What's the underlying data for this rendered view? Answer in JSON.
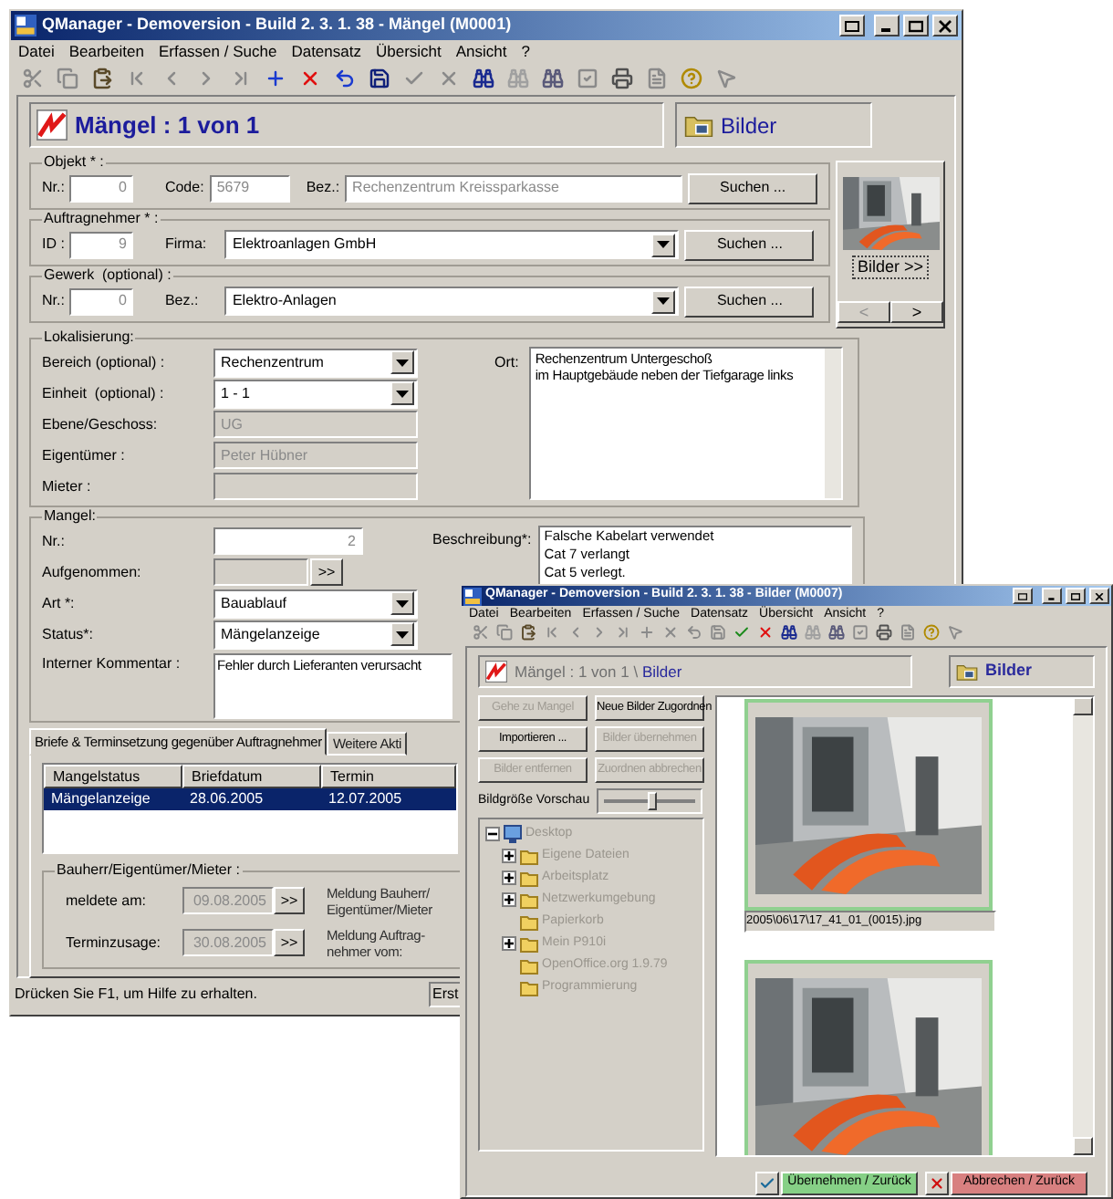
{
  "main_window": {
    "title": "QManager - Demoversion - Build 2. 3. 1. 38 - Mängel (M0001)",
    "menu": [
      "Datei",
      "Bearbeiten",
      "Erfassen / Suche",
      "Datensatz",
      "Übersicht",
      "Ansicht",
      "?"
    ],
    "header": {
      "title": "Mängel : 1 von 1",
      "images_label": "Bilder"
    },
    "objekt": {
      "legend": "Objekt * :",
      "nr_label": "Nr.:",
      "nr": "0",
      "code_label": "Code:",
      "code": "5679",
      "bez_label": "Bez.:",
      "bez": "Rechenzentrum Kreissparkasse",
      "button": "Suchen ..."
    },
    "auftragnehmer": {
      "legend": "Auftragnehmer * :",
      "id_label": "ID :",
      "id": "9",
      "firma_label": "Firma:",
      "firma": "Elektroanlagen GmbH",
      "button": "Suchen ..."
    },
    "gewerk": {
      "legend": "Gewerk  (optional) :",
      "nr_label": "Nr.:",
      "nr": "0",
      "bez_label": "Bez.:",
      "bez": "Elektro-Anlagen",
      "button": "Suchen ..."
    },
    "thumbnail": {
      "kind": "picture",
      "button": "Bilder >>",
      "prev": "<",
      "next": ">"
    },
    "lokalisierung": {
      "legend": "Lokalisierung:",
      "fields": [
        {
          "label": "Bereich (optional) :",
          "value": "Rechenzentrum",
          "kind": "combo"
        },
        {
          "label": "Einheit  (optional) :",
          "value": "1 - 1",
          "kind": "combo"
        },
        {
          "label": "Ebene/Geschoss:",
          "value": "UG",
          "kind": "readonly"
        },
        {
          "label": "Eigentümer :",
          "value": "Peter Hübner",
          "kind": "readonly"
        },
        {
          "label": "Mieter :",
          "kind": "readonly"
        }
      ],
      "ort_label": "Ort:",
      "ort": [
        "Rechenzentrum Untergeschoß",
        "im Hauptgebäude neben der Tiefgarage links"
      ]
    },
    "mangel": {
      "legend": "Mangel:",
      "fields": [
        {
          "label": "Nr.:",
          "value": "2",
          "kind": "number"
        },
        {
          "label": "Aufgenommen:",
          "kind": "date",
          "button": ">>"
        },
        {
          "label": "Art *:",
          "value": "Bauablauf",
          "kind": "combo"
        },
        {
          "label": "Status*:",
          "value": "Mängelanzeige",
          "kind": "combo"
        }
      ],
      "beschreibung_label": "Beschreibung*:",
      "beschreibung": [
        "Falsche Kabelart verwendet",
        "Cat 7 verlangt",
        "Cat 5 verlegt."
      ],
      "kommentar_label": "Interner Kommentar :",
      "kommentar": "Fehler durch Lieferanten verursacht"
    },
    "tabs": [
      {
        "label": "Briefe & Terminsetzung gegenüber Auftragnehmer",
        "selected": true
      },
      {
        "label": "Weitere Akti",
        "selected": false
      }
    ],
    "table": {
      "columns": [
        "Mangelstatus",
        "Briefdatum",
        "Termin"
      ],
      "rows": [
        {
          "cells": [
            "Mängelanzeige",
            "28.06.2005",
            "12.07.2005"
          ],
          "selected": true
        }
      ]
    },
    "bauherr": {
      "legend": "Bauherr/Eigentümer/Mieter :",
      "rows": [
        {
          "label": "meldete am:",
          "value": "09.08.2005",
          "button": ">>",
          "note": [
            "Meldung Bauherr/",
            "Eigentümer/Mieter"
          ]
        },
        {
          "label": "Terminzusage:",
          "value": "30.08.2005",
          "button": ">>",
          "note": [
            "Meldung Auftrag-",
            "nehmer vom:"
          ]
        }
      ]
    },
    "status_bar": [
      "Drücken Sie F1, um Hilfe zu erhalten.",
      "Erst"
    ]
  },
  "images_window": {
    "title": "QManager - Demoversion - Build 2. 3. 1. 38 - Bilder (M0007)",
    "menu": [
      "Datei",
      "Bearbeiten",
      "Erfassen / Suche",
      "Datensatz",
      "Übersicht",
      "Ansicht",
      "?"
    ],
    "header": {
      "path": "Mängel : 1 von 1 \\",
      "current": "Bilder",
      "images_label": "Bilder"
    },
    "buttons": [
      {
        "label": "Gehe zu Mangel",
        "disabled": true
      },
      {
        "label": "Neue Bilder Zugordnen",
        "disabled": false
      },
      {
        "label": "Importieren ...",
        "disabled": false
      },
      {
        "label": "Bilder übernehmen",
        "disabled": true
      },
      {
        "label": "Bilder entfernen",
        "disabled": true
      },
      {
        "label": "Zuordnen abbrechen",
        "disabled": true
      }
    ],
    "slider": {
      "label": "Bildgröße Vorschau",
      "level": 0.55
    },
    "tree": {
      "disabled": true,
      "items": [
        {
          "label": "Desktop",
          "expandable": true,
          "expanded": true,
          "children": [
            {
              "label": "Eigene Dateien",
              "expandable": true,
              "expanded": false
            },
            {
              "label": "Arbeitsplatz",
              "expandable": true,
              "expanded": false
            },
            {
              "label": "Netzwerkumgebung",
              "expandable": true,
              "expanded": false
            },
            {
              "label": "Papierkorb",
              "expandable": false,
              "expanded": false
            },
            {
              "label": "Mein P910i",
              "expandable": true,
              "expanded": false
            },
            {
              "label": "OpenOffice.org 1.9.79",
              "expandable": false,
              "expanded": false
            },
            {
              "label": "Programmierung",
              "expandable": false,
              "expanded": false
            }
          ]
        }
      ]
    },
    "images": [
      {
        "kind": "picture",
        "caption": "2005\\06\\17\\17_41_01_(0015).jpg"
      },
      {
        "kind": "picture"
      }
    ],
    "footer_buttons": [
      {
        "label": "Übernehmen / Zurück",
        "kind": "ok"
      },
      {
        "label": "Abbrechen / Zurück",
        "kind": "cancel"
      }
    ]
  }
}
